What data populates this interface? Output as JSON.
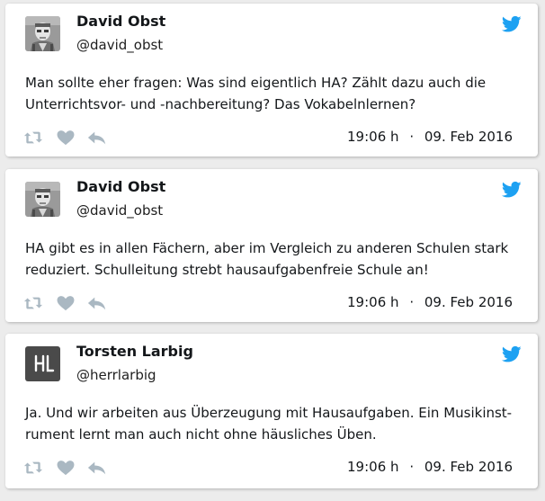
{
  "colors": {
    "twitter_blue": "#1da1f2",
    "action_gray": "#aab8c2"
  },
  "icons": {
    "brand": "twitter-bird-icon",
    "retweet": "retweet-icon",
    "like": "heart-icon",
    "reply": "reply-icon"
  },
  "tweets": [
    {
      "name": "David Obst",
      "handle": "@david_obst",
      "lines": [
        "Man sollte eher fragen: Was sind eigentlich HA? Zählt dazu auch die",
        "Unterrichtsvor- und -nachbereitung? Das Vokabelnlernen?"
      ],
      "time": "19:06 h",
      "separator": "·",
      "date": "09. Feb 2016"
    },
    {
      "name": "David Obst",
      "handle": "@david_obst",
      "lines": [
        "HA gibt es in allen Fächern, aber im Vergleich zu anderen Schulen stark",
        "reduziert. Schulleitung strebt hausaufgabenfreie Schule an!"
      ],
      "time": "19:06 h",
      "separator": "·",
      "date": "09. Feb 2016"
    },
    {
      "name": "Torsten Larbig",
      "handle": "@herrlarbig",
      "avatar_letters": "H L",
      "lines": [
        "Ja. Und wir arbeiten aus Überzeugung mit Hausaufgaben. Ein Musikinst-",
        "rument lernt man auch nicht ohne häusliches Üben."
      ],
      "time": "19:06 h",
      "separator": "·",
      "date": "09. Feb 2016"
    }
  ]
}
